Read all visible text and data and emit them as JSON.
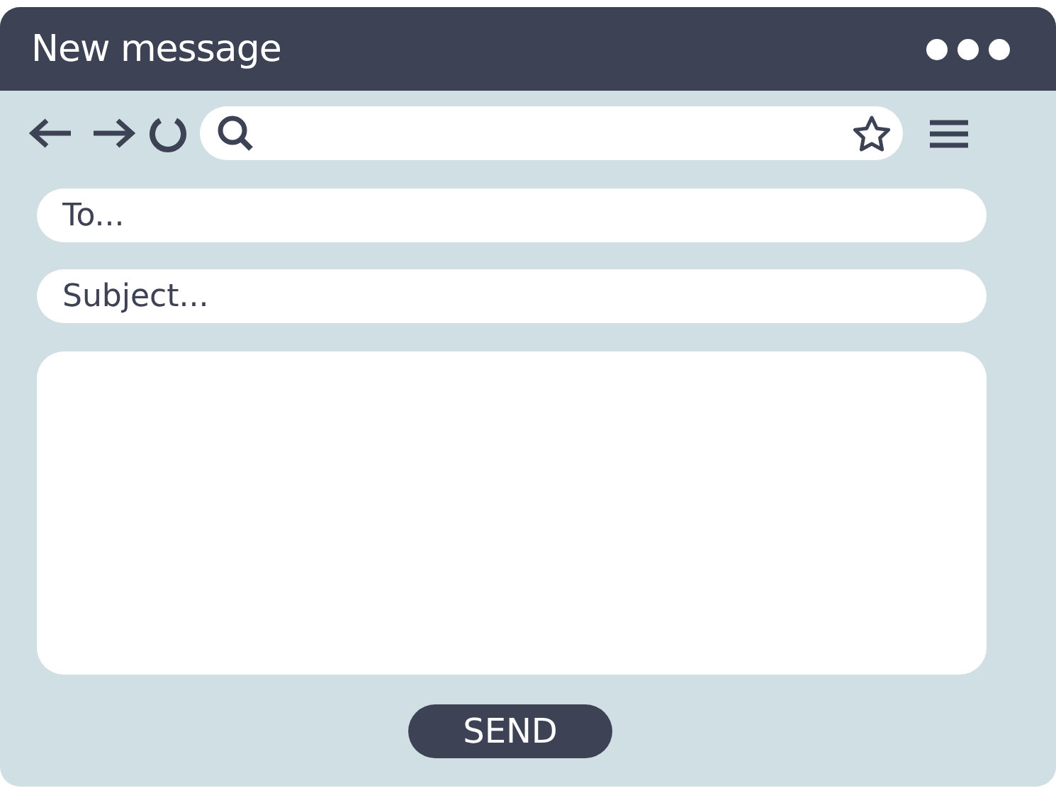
{
  "window": {
    "title": "New message"
  },
  "to": {
    "placeholder": "To..."
  },
  "subject": {
    "placeholder": "Subject..."
  },
  "send_button": {
    "label": "SEND"
  }
}
